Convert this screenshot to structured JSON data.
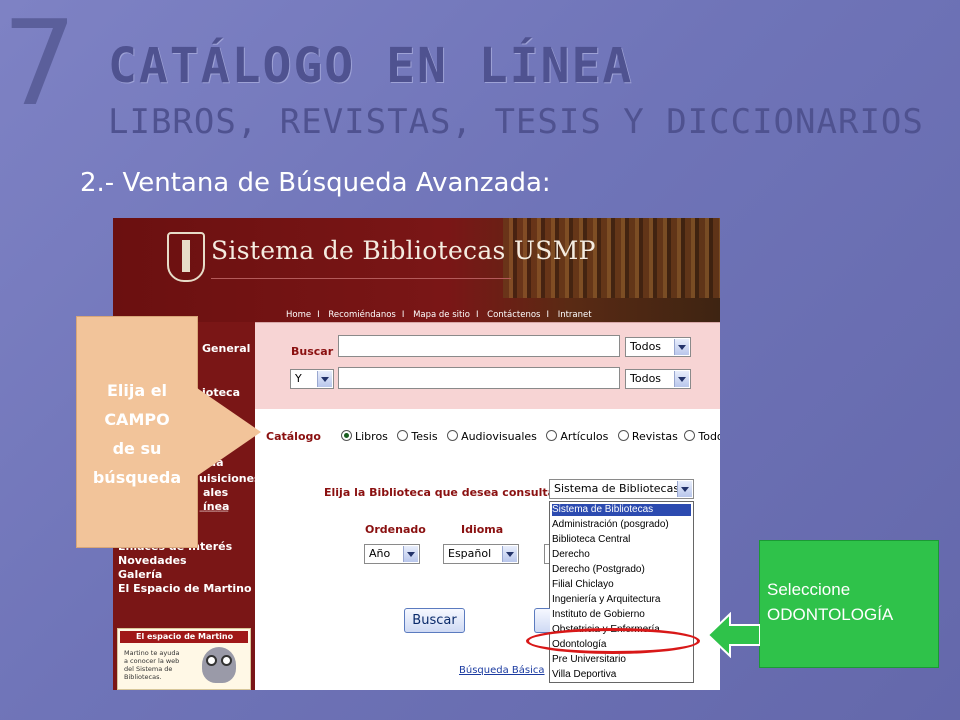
{
  "slide": {
    "number": "7",
    "title": "CATÁLOGO EN LÍNEA",
    "subtitle": "LIBROS, REVISTAS, TESIS Y DICCIONARIOS",
    "step": "2.- Ventana de Búsqueda Avanzada:"
  },
  "site": {
    "brand": "Sistema de Bibliotecas USMP",
    "nav": [
      "Home",
      "Recomiéndanos",
      "Mapa de sitio",
      "Contáctenos",
      "Intranet"
    ],
    "nav_separator": "I"
  },
  "sidebar": {
    "items_top": [
      "General",
      "ioteca",
      "tua",
      "uisiciones",
      "ales",
      "ínea"
    ],
    "items_bottom": [
      "Enlaces de Interés",
      "Novedades",
      "Galería",
      "El Espacio de Martino"
    ],
    "martino_title": "El espacio de Martino",
    "martino_text": "Martino te ayuda a conocer la web del Sistema de Bibliotecas."
  },
  "search": {
    "buscar_label": "Buscar",
    "row1_field_select": "Todos",
    "operator": "Y",
    "row2_field_select": "Todos",
    "row1_value": "",
    "row2_value": ""
  },
  "catalog": {
    "label": "Catálogo",
    "options": [
      "Libros",
      "Tesis",
      "Audiovisuales",
      "Artículos",
      "Revistas",
      "Todos"
    ],
    "selected": "Libros"
  },
  "library": {
    "label": "Elija la Biblioteca que desea consultar",
    "selected": "Sistema de Bibliotecas",
    "options": [
      "Sistema de Bibliotecas",
      "Administración (posgrado)",
      "Biblioteca Central",
      "Derecho",
      "Derecho (Postgrado)",
      "Filial Chiclayo",
      "Ingeniería y Arquitectura",
      "Instituto de Gobierno",
      "Obstetricia y Enfermería",
      "Odontología",
      "Pre Universitario",
      "Villa Deportiva"
    ],
    "highlighted": "Odontología"
  },
  "sort": {
    "label": "Ordenado",
    "value": "Año"
  },
  "language": {
    "label": "Idioma",
    "value": "Español"
  },
  "actions": {
    "search_button": "Buscar",
    "basic_search_link": "Búsqueda Básica"
  },
  "callouts": {
    "left_lines": [
      "Elija el",
      "CAMPO",
      "de su",
      "búsqueda"
    ],
    "right_lines": [
      "Seleccione",
      "ODONTOLOGÍA"
    ]
  },
  "colors": {
    "slide_bg": "#7478bc",
    "site_header": "#7a1616",
    "search_band": "#f7d4d4",
    "label_red": "#8a1010",
    "selected_option": "#2c4bb0",
    "callout_orange": "#f2c49a",
    "callout_green": "#2fc24a",
    "highlight_oval": "#d81818"
  }
}
